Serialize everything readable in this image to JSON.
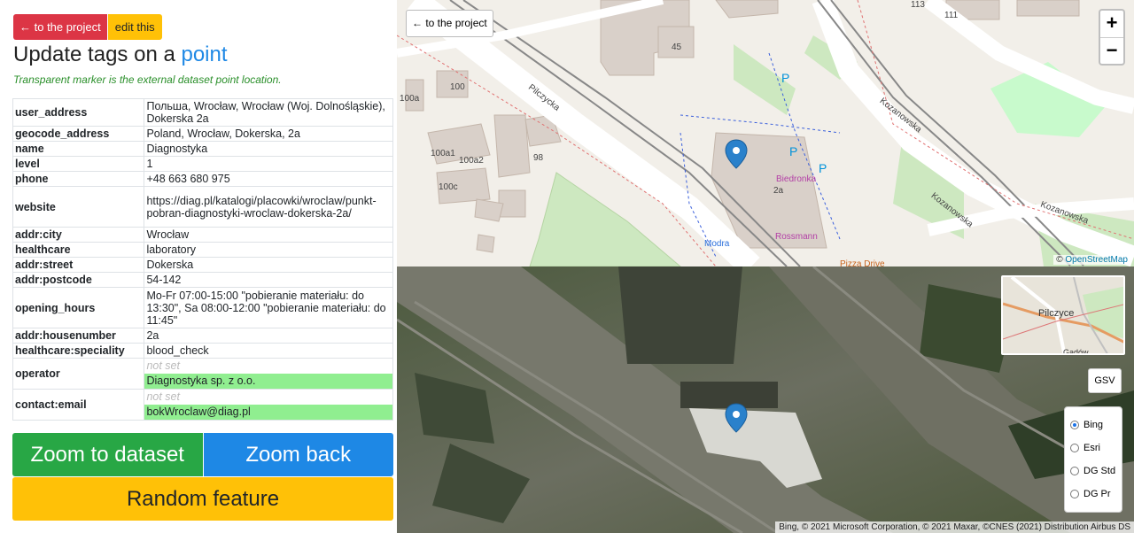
{
  "left": {
    "back_button": "← to the project",
    "edit_button": "edit this",
    "title_prefix": "Update tags on a ",
    "title_link": "point",
    "note": "Transparent marker is the external dataset point location.",
    "rows": [
      {
        "key": "user_address",
        "value": "Польша, Wrocław, Wrocław (Woj. Dolnośląskie), Dokerska 2a"
      },
      {
        "key": "geocode_address",
        "value": "Poland, Wrocław, Dokerska, 2a"
      },
      {
        "key": "name",
        "value": "Diagnostyka"
      },
      {
        "key": "level",
        "value": "1"
      },
      {
        "key": "phone",
        "value": "+48 663 680 975"
      },
      {
        "key": "website",
        "value": " https://diag.pl/katalogi/placowki/wroclaw/punkt-pobran-diagnostyki-wroclaw-dokerska-2a/"
      },
      {
        "key": "addr:city",
        "value": "Wrocław"
      },
      {
        "key": "healthcare",
        "value": "laboratory"
      },
      {
        "key": "addr:street",
        "value": "Dokerska"
      },
      {
        "key": "addr:postcode",
        "value": "54-142"
      },
      {
        "key": "opening_hours",
        "value": "Mo-Fr 07:00-15:00 \"pobieranie materiału: do 13:30\", Sa 08:00-12:00 \"pobieranie materiału: do 11:45\""
      },
      {
        "key": "addr:housenumber",
        "value": "2a"
      },
      {
        "key": "healthcare:speciality",
        "value": "blood_check"
      },
      {
        "key": "operator",
        "old": "not set",
        "new": "Diagnostyka sp. z o.o."
      },
      {
        "key": "contact:email",
        "old": "not set",
        "new": "bokWroclaw@diag.pl"
      }
    ],
    "zoom_dataset": "Zoom to dataset",
    "zoom_back": "Zoom back",
    "random_feature": "Random feature"
  },
  "map": {
    "project_button": "← to the project",
    "zoom_in": "+",
    "zoom_out": "−",
    "attribution_prefix": "© ",
    "attribution_link": "OpenStreetMap",
    "labels": {
      "pilczycka": "Pilczycka",
      "kozanowska1": "Kozanowska",
      "kozanowska2": "Kozanowska",
      "kozanowska3": "Kozanowska",
      "biedronka": "Biedronka",
      "rossmann": "Rossmann",
      "modra": "Modra",
      "pizza": "Pizza Drive",
      "n100": "100",
      "n100a": "100a",
      "n100a1": "100a1",
      "n100a2": "100a2",
      "n100c": "100c",
      "n98": "98",
      "n2a": "2a",
      "n45": "45",
      "n113": "113",
      "n111": "111"
    }
  },
  "sat": {
    "gsv": "GSV",
    "layers": [
      "Bing",
      "Esri",
      "DG Std",
      "DG Pr"
    ],
    "selected_layer": "Bing",
    "minimap_label1": "Pilczyce",
    "minimap_label2": "Gądów",
    "attribution": "Bing, © 2021 Microsoft Corporation, © 2021 Maxar, ©CNES (2021) Distribution Airbus DS"
  }
}
